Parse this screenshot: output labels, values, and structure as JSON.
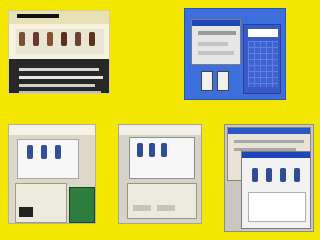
{
  "colors": {
    "background": "#f3e600",
    "window_blue": "#3d6fdc",
    "title_blue": "#1f46b8",
    "light_panel": "#dedede",
    "dark_panel": "#333333",
    "calendar_blue": "#3859c6",
    "green_card": "#2f7d3d",
    "white": "#ffffff"
  },
  "thumbnails": [
    {
      "icon": "desktop-screenshot-icon"
    },
    {
      "icon": "window-calendar-screenshot-icon"
    },
    {
      "icon": "game-board-screenshot-icon"
    },
    {
      "icon": "dialog-screenshot-icon"
    },
    {
      "icon": "stacked-windows-screenshot-icon"
    }
  ]
}
